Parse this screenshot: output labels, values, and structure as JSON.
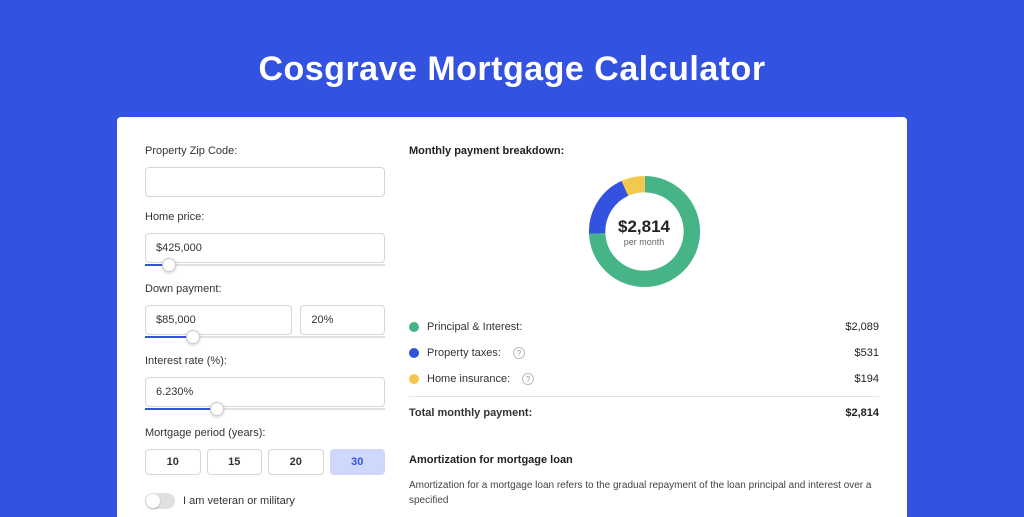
{
  "title": "Cosgrave Mortgage Calculator",
  "colors": {
    "principal": "#46b487",
    "taxes": "#3452e0",
    "insurance": "#f2c94c"
  },
  "form": {
    "zip_label": "Property Zip Code:",
    "zip_value": "",
    "home_price_label": "Home price:",
    "home_price_value": "$425,000",
    "home_price_slider_pct": 10,
    "down_payment_label": "Down payment:",
    "down_payment_value": "$85,000",
    "down_payment_pct": "20%",
    "down_payment_slider_pct": 20,
    "interest_label": "Interest rate (%):",
    "interest_value": "6.230%",
    "interest_slider_pct": 30,
    "period_label": "Mortgage period (years):",
    "period_options": [
      "10",
      "15",
      "20",
      "30"
    ],
    "period_selected": "30",
    "veteran_label": "I am veteran or military",
    "veteran_on": false
  },
  "breakdown": {
    "title": "Monthly payment breakdown:",
    "center_amount": "$2,814",
    "center_sub": "per month",
    "items": [
      {
        "key": "principal",
        "label": "Principal & Interest:",
        "value": "$2,089",
        "help": false
      },
      {
        "key": "taxes",
        "label": "Property taxes:",
        "value": "$531",
        "help": true
      },
      {
        "key": "insurance",
        "label": "Home insurance:",
        "value": "$194",
        "help": true
      }
    ],
    "total_label": "Total monthly payment:",
    "total_value": "$2,814"
  },
  "amortization": {
    "title": "Amortization for mortgage loan",
    "desc": "Amortization for a mortgage loan refers to the gradual repayment of the loan principal and interest over a specified"
  },
  "chart_data": {
    "type": "pie",
    "title": "Monthly payment breakdown",
    "series": [
      {
        "name": "Principal & Interest",
        "value": 2089,
        "color": "#46b487"
      },
      {
        "name": "Property taxes",
        "value": 531,
        "color": "#3452e0"
      },
      {
        "name": "Home insurance",
        "value": 194,
        "color": "#f2c94c"
      }
    ],
    "total": 2814,
    "center_label": "$2,814 per month"
  }
}
